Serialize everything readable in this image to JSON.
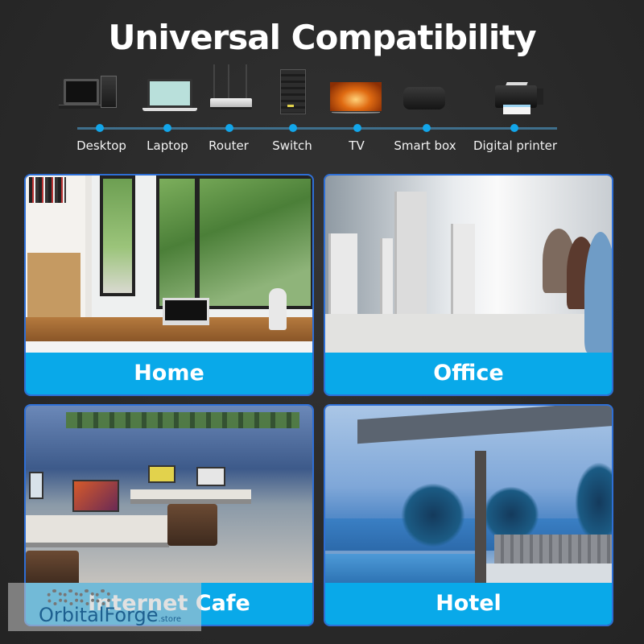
{
  "title": "Universal Compatibility",
  "devices": [
    {
      "label": "Desktop",
      "icon": "desktop-computer-icon"
    },
    {
      "label": "Laptop",
      "icon": "laptop-icon"
    },
    {
      "label": "Router",
      "icon": "router-icon"
    },
    {
      "label": "Switch",
      "icon": "network-switch-icon"
    },
    {
      "label": "TV",
      "icon": "tv-icon"
    },
    {
      "label": "Smart box",
      "icon": "smart-box-icon"
    },
    {
      "label": "Digital printer",
      "icon": "printer-icon"
    }
  ],
  "scenarios": [
    {
      "label": "Home",
      "image": "home-office-photo"
    },
    {
      "label": "Office",
      "image": "office-workstations-photo"
    },
    {
      "label": "Internet Cafe",
      "image": "internet-cafe-photo"
    },
    {
      "label": "Hotel",
      "image": "hotel-poolside-photo"
    }
  ],
  "watermark": {
    "brand": "OrbitalForge",
    "suffix": ".store"
  },
  "colors": {
    "background": "#2a2a2a",
    "accent_band": "#09a9e9",
    "card_border": "#2e6fd6",
    "timeline_dot": "#12a6ea",
    "timeline_line": "#3f6f8c"
  }
}
